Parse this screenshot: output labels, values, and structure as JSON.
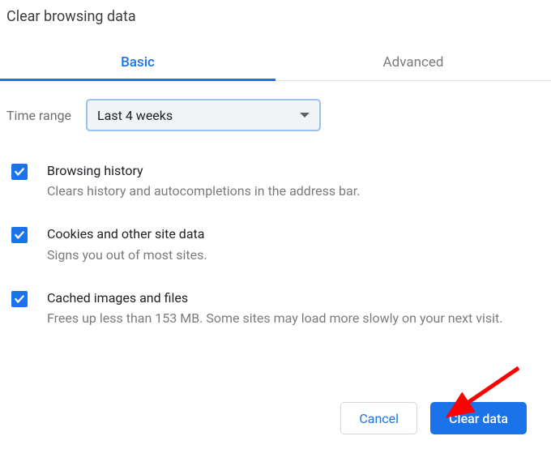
{
  "title": "Clear browsing data",
  "tabs": {
    "basic": "Basic",
    "advanced": "Advanced"
  },
  "timerange": {
    "label": "Time range",
    "value": "Last 4 weeks"
  },
  "options": [
    {
      "title": "Browsing history",
      "desc": "Clears history and autocompletions in the address bar.",
      "checked": true
    },
    {
      "title": "Cookies and other site data",
      "desc": "Signs you out of most sites.",
      "checked": true
    },
    {
      "title": "Cached images and files",
      "desc": "Frees up less than 153 MB. Some sites may load more slowly on your next visit.",
      "checked": true
    }
  ],
  "buttons": {
    "cancel": "Cancel",
    "clear": "Clear data"
  },
  "annotation": {
    "arrow_color": "#ff0000"
  }
}
